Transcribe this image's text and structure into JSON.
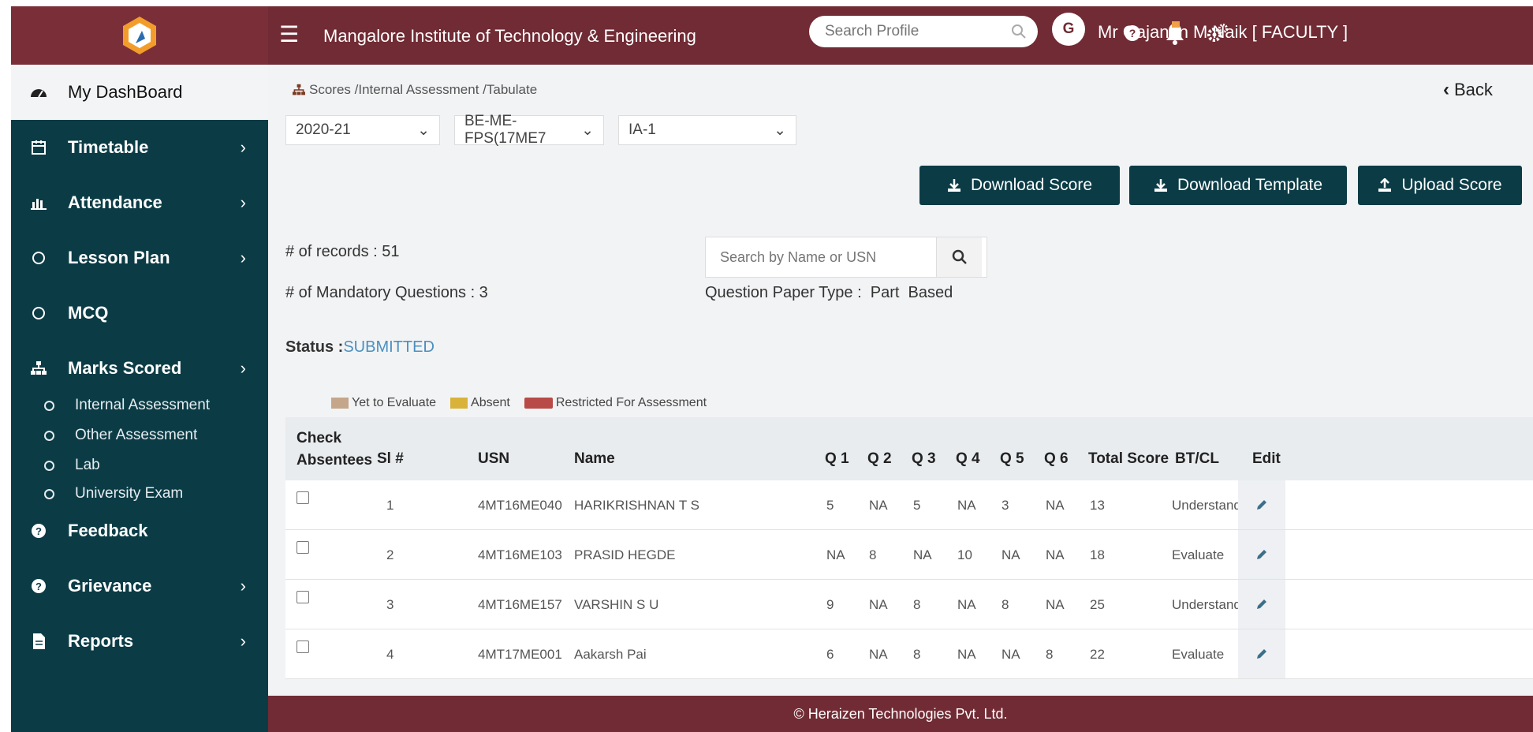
{
  "header": {
    "institute": "Mangalore Institute of Technology & Engineering",
    "search_placeholder": "Search Profile",
    "avatar_initial": "G",
    "user": "Mr Gajanan M Naik [ FACULTY ]"
  },
  "sidebar": {
    "items": [
      {
        "label": "My DashBoard",
        "icon": "dashboard-icon"
      },
      {
        "label": "Timetable",
        "icon": "calendar-icon"
      },
      {
        "label": "Attendance",
        "icon": "bar-chart-icon"
      },
      {
        "label": "Lesson Plan",
        "icon": "circle-icon"
      },
      {
        "label": "MCQ",
        "icon": "circle-icon"
      },
      {
        "label": "Marks Scored",
        "icon": "sitemap-icon"
      },
      {
        "label": "Feedback",
        "icon": "question-circle-icon"
      },
      {
        "label": "Grievance",
        "icon": "question-circle-icon"
      },
      {
        "label": "Reports",
        "icon": "file-icon"
      }
    ],
    "subitems": [
      "Internal Assessment",
      "Other Assessment",
      "Lab",
      "University Exam"
    ]
  },
  "breadcrumb": "Scores /Internal Assessment /Tabulate",
  "back_label": "Back",
  "filters": {
    "year": "2020-21",
    "course": "BE-ME-FPS(17ME7",
    "assessment": "IA-1"
  },
  "buttons": {
    "download_score": "Download Score",
    "download_template": "Download Template",
    "upload_score": "Upload Score"
  },
  "info": {
    "records": "# of records : 51",
    "mandatory": "# of Mandatory Questions : 3",
    "search_placeholder": "Search by Name or USN",
    "paper_type": "Question Paper Type :  Part  Based",
    "status_key": "Status :",
    "status_value": "SUBMITTED"
  },
  "legend": [
    {
      "label": "Yet to Evaluate",
      "color": "#c4a68a"
    },
    {
      "label": "Absent",
      "color": "#d9b23a"
    },
    {
      "label": "Restricted For Assessment",
      "color": "#b84a47"
    }
  ],
  "table": {
    "headers": {
      "check1": "Check",
      "check2": "Absentees",
      "sl": "Sl #",
      "usn": "USN",
      "name": "Name",
      "q1": "Q 1",
      "q2": "Q 2",
      "q3": "Q 3",
      "q4": "Q 4",
      "q5": "Q 5",
      "q6": "Q 6",
      "total": "Total Score",
      "btcl": "BT/CL",
      "edit": "Edit"
    },
    "rows": [
      {
        "sl": "1",
        "usn": "4MT16ME040",
        "name": "HARIKRISHNAN T S",
        "q1": "5",
        "q2": "NA",
        "q3": "5",
        "q4": "NA",
        "q5": "3",
        "q6": "NA",
        "total": "13",
        "btcl": "Understand"
      },
      {
        "sl": "2",
        "usn": "4MT16ME103",
        "name": "PRASID HEGDE",
        "q1": "NA",
        "q2": "8",
        "q3": "NA",
        "q4": "10",
        "q5": "NA",
        "q6": "NA",
        "total": "18",
        "btcl": "Evaluate"
      },
      {
        "sl": "3",
        "usn": "4MT16ME157",
        "name": "VARSHIN S U",
        "q1": "9",
        "q2": "NA",
        "q3": "8",
        "q4": "NA",
        "q5": "8",
        "q6": "NA",
        "total": "25",
        "btcl": "Understand"
      },
      {
        "sl": "4",
        "usn": "4MT17ME001",
        "name": "Aakarsh Pai",
        "q1": "6",
        "q2": "NA",
        "q3": "8",
        "q4": "NA",
        "q5": "NA",
        "q6": "8",
        "total": "22",
        "btcl": "Evaluate"
      }
    ]
  },
  "footer": "© Heraizen Technologies Pvt. Ltd.",
  "colors": {
    "brand": "#712b34",
    "sidebar": "#0b3c46",
    "status": "#4a90c0"
  }
}
